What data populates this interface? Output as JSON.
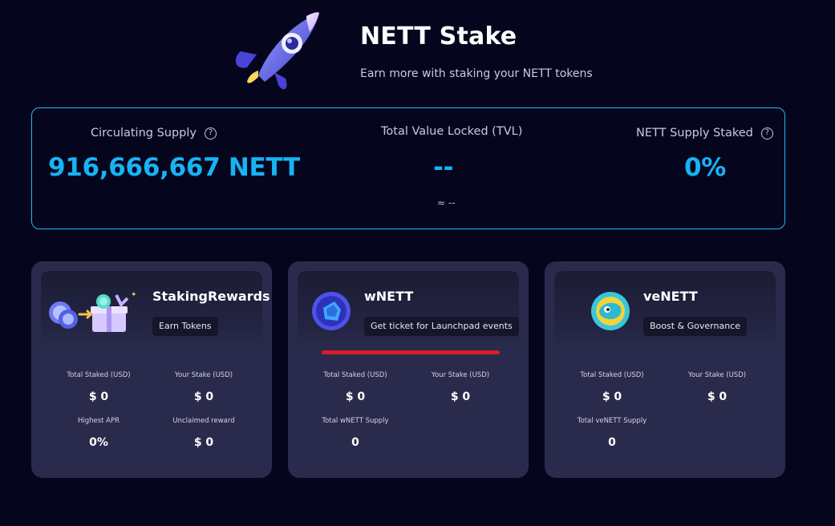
{
  "header": {
    "title": "NETT Stake",
    "subtitle": "Earn more with staking your NETT tokens",
    "logo_icon": "rocket-icon"
  },
  "stats": {
    "circulating": {
      "label": "Circulating Supply",
      "value": "916,666,667 NETT",
      "help_icon": "question-circle-icon"
    },
    "tvl": {
      "label": "Total Value Locked (TVL)",
      "value": "--",
      "sub": "≈ --"
    },
    "staked": {
      "label": "NETT Supply Staked",
      "value": "0%",
      "help_icon": "question-circle-icon"
    }
  },
  "cards": [
    {
      "name": "StakingRewards",
      "tag": "Earn Tokens",
      "icon": "gift-tokens-icon",
      "metrics": [
        {
          "label": "Total Staked (USD)",
          "value": "$ 0"
        },
        {
          "label": "Your Stake (USD)",
          "value": "$ 0"
        },
        {
          "label": "Highest APR",
          "value": "0%"
        },
        {
          "label": "Unclaimed reward",
          "value": "$ 0"
        }
      ]
    },
    {
      "name": "wNETT",
      "tag": "Get ticket for Launchpad events",
      "icon": "wnett-token-icon",
      "metrics": [
        {
          "label": "Total Staked (USD)",
          "value": "$ 0"
        },
        {
          "label": "Your Stake (USD)",
          "value": "$ 0"
        },
        {
          "label": "Total wNETT Supply",
          "value": "0"
        }
      ]
    },
    {
      "name": "veNETT",
      "tag": "Boost & Governance",
      "icon": "venett-token-icon",
      "metrics": [
        {
          "label": "Total Staked (USD)",
          "value": "$ 0"
        },
        {
          "label": "Your Stake (USD)",
          "value": "$ 0"
        },
        {
          "label": "Total veNETT Supply",
          "value": "0"
        }
      ]
    }
  ],
  "colors": {
    "background": "#05061e",
    "accent": "#17b3f5",
    "panel_border": "#21b8f0",
    "card": "#2a2b4c",
    "highlight": "#dc1c24"
  }
}
